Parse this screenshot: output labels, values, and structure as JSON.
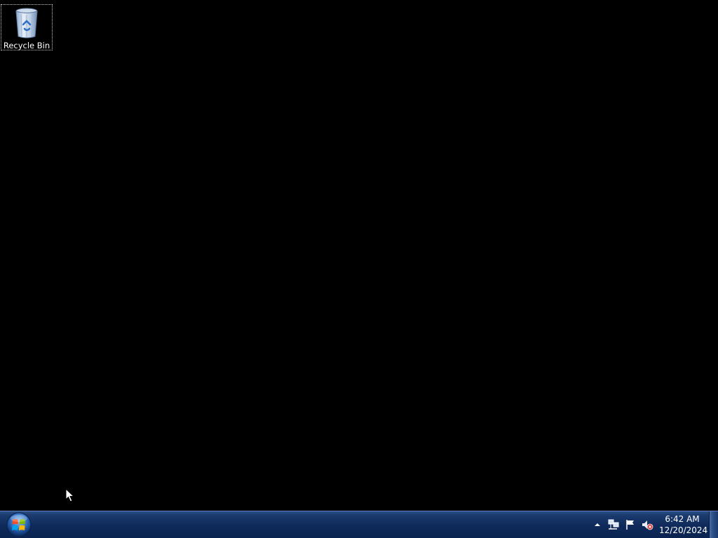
{
  "desktop": {
    "background_color": "#000000",
    "icons": [
      {
        "label": "Recycle Bin",
        "icon": "recycle-bin-icon"
      }
    ]
  },
  "taskbar": {
    "start_icon": "windows-start-orb-icon",
    "tray_icons": [
      "show-hidden-icons-arrow",
      "network-icon",
      "action-center-flag-icon",
      "volume-muted-icon"
    ],
    "clock": {
      "time": "6:42 AM",
      "date": "12/20/2024"
    }
  }
}
